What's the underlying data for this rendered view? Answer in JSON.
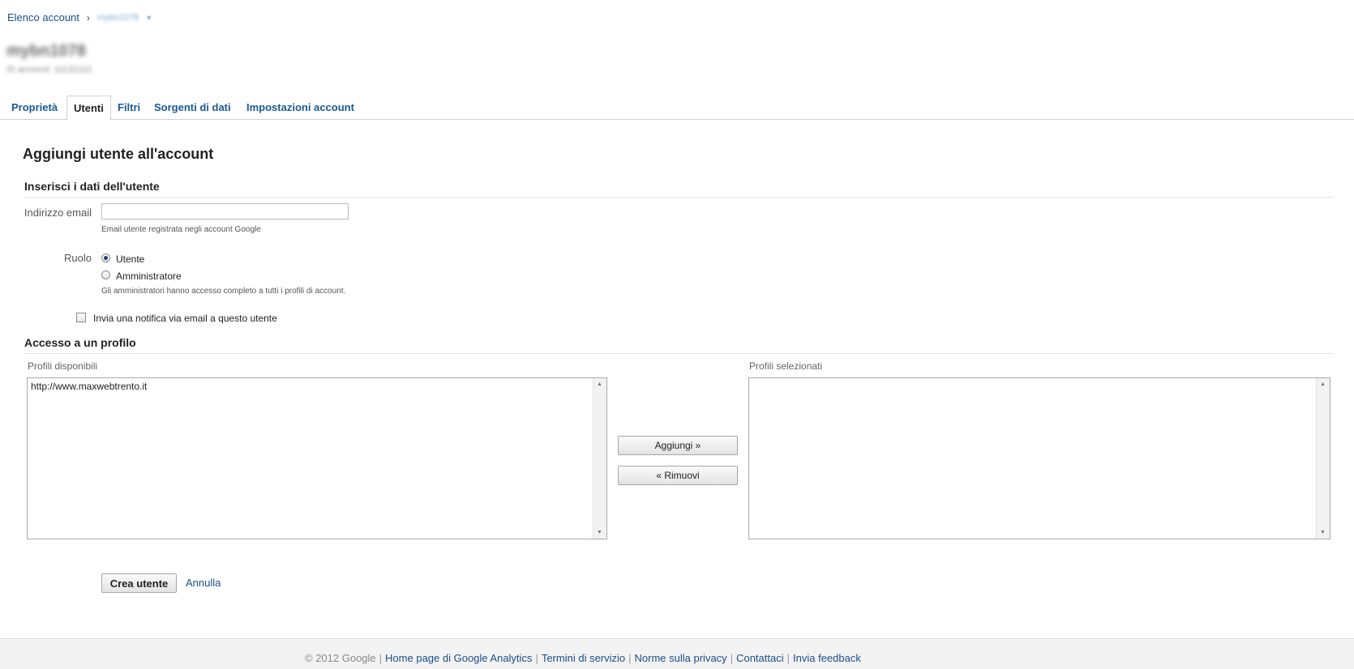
{
  "breadcrumb": {
    "root": "Elenco account",
    "separator": "›",
    "current": "mybn1078",
    "dropdown_icon": "chevron-down-icon"
  },
  "account": {
    "name": "mybn1078",
    "id_text": "ID account: 11132112"
  },
  "tabs": [
    {
      "label": "Proprietà"
    },
    {
      "label": "Utenti"
    },
    {
      "label": "Filtri"
    },
    {
      "label": "Sorgenti di dati"
    },
    {
      "label": "Impostazioni account"
    }
  ],
  "active_tab": "Utenti",
  "page_title": "Aggiungi utente all'account",
  "user_section": {
    "heading": "Inserisci i dati dell'utente",
    "email_label": "Indirizzo email",
    "email_value": "",
    "email_help": "Email utente registrata negli account Google",
    "role_label": "Ruolo",
    "role_options": [
      {
        "label": "Utente",
        "checked": true
      },
      {
        "label": "Amministratore",
        "checked": false
      }
    ],
    "role_help": "Gli amministratori hanno accesso completo a tutti i profili di account.",
    "notify_label": "Invia una notifica via email a questo utente",
    "notify_checked": false
  },
  "profile_section": {
    "heading": "Accesso a un profilo",
    "available_label": "Profili disponibili",
    "available_items": [
      "http://www.maxwebtrento.it"
    ],
    "selected_label": "Profili selezionati",
    "selected_items": [],
    "add_button": "Aggiungi »",
    "remove_button": "« Rimuovi"
  },
  "actions": {
    "create_button": "Crea utente",
    "cancel_link": "Annulla"
  },
  "footer": {
    "copyright": "© 2012 Google",
    "links": [
      "Home page di Google Analytics",
      "Termini di servizio",
      "Norme sulla privacy",
      "Contattaci",
      "Invia feedback"
    ]
  },
  "colors": {
    "link": "#1a4e8a",
    "tab_link": "#1a5a96",
    "border": "#cfcfcf",
    "footer_bg": "#f3f3f3"
  }
}
